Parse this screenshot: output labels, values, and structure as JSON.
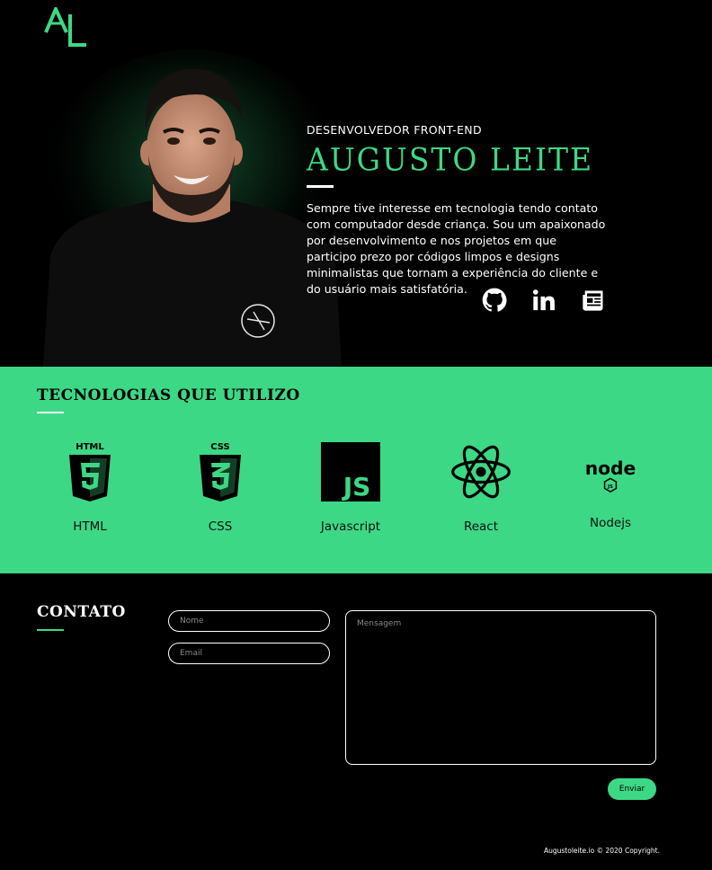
{
  "brand": {
    "logo_text": "AL",
    "accent": "#3dd885"
  },
  "hero": {
    "subtitle": "DESENVOLVEDOR FRONT-END",
    "name": "AUGUSTO LEITE",
    "bio": "Sempre tive interesse em tecnologia tendo contato com computador desde criança. Sou um apaixonado por desenvolvimento e nos projetos em que participo prezo por códigos limpos e designs minimalistas que tornam a experiência do cliente e do usuário mais satisfatória.",
    "socials": [
      {
        "icon": "github-icon"
      },
      {
        "icon": "linkedin-icon"
      },
      {
        "icon": "resume-icon"
      }
    ]
  },
  "tech": {
    "title": "TECNOLOGIAS QUE UTILIZO",
    "items": [
      {
        "label": "HTML",
        "icon": "html5-icon"
      },
      {
        "label": "CSS",
        "icon": "css3-icon"
      },
      {
        "label": "Javascript",
        "icon": "javascript-icon"
      },
      {
        "label": "React",
        "icon": "react-icon"
      },
      {
        "label": "Nodejs",
        "icon": "nodejs-icon"
      }
    ]
  },
  "contact": {
    "title": "CONTATO",
    "name_placeholder": "Nome",
    "email_placeholder": "Email",
    "message_placeholder": "Mensagem",
    "send_label": "Enviar"
  },
  "footer": {
    "copyright": "Augustoleite.io © 2020 Copyright."
  }
}
